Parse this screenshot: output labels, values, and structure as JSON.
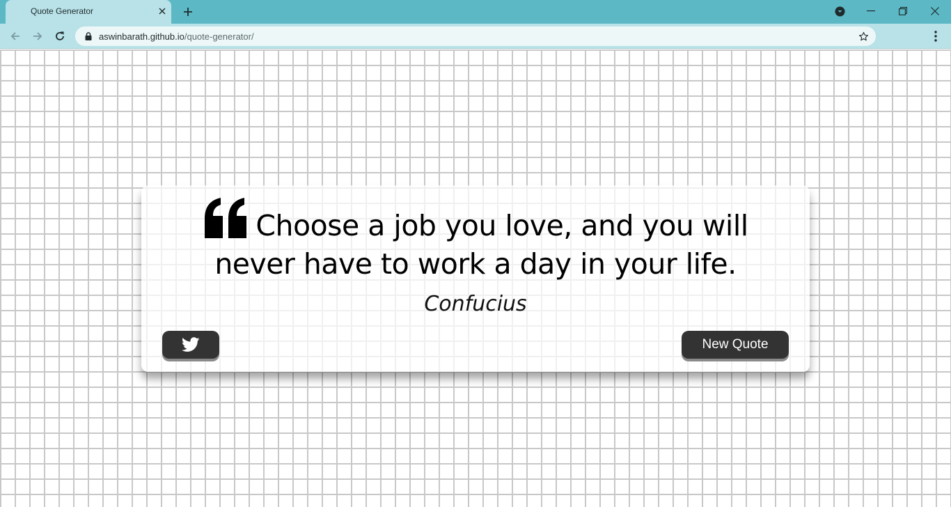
{
  "browser": {
    "tab_title": "Quote Generator",
    "url_host": "aswinbarath.github.io",
    "url_path": "/quote-generator/"
  },
  "quote": {
    "text": "Choose a job you love, and you will never have to work a day in your life.",
    "author": "Confucius",
    "icon": "quote-left-icon"
  },
  "buttons": {
    "twitter_icon": "twitter-icon",
    "new_quote_label": "New Quote"
  },
  "colors": {
    "tabbar": "#5bb8c4",
    "toolbar": "#b8e2e8",
    "button": "#333333",
    "brick_mortar": "#c8c8c8"
  }
}
